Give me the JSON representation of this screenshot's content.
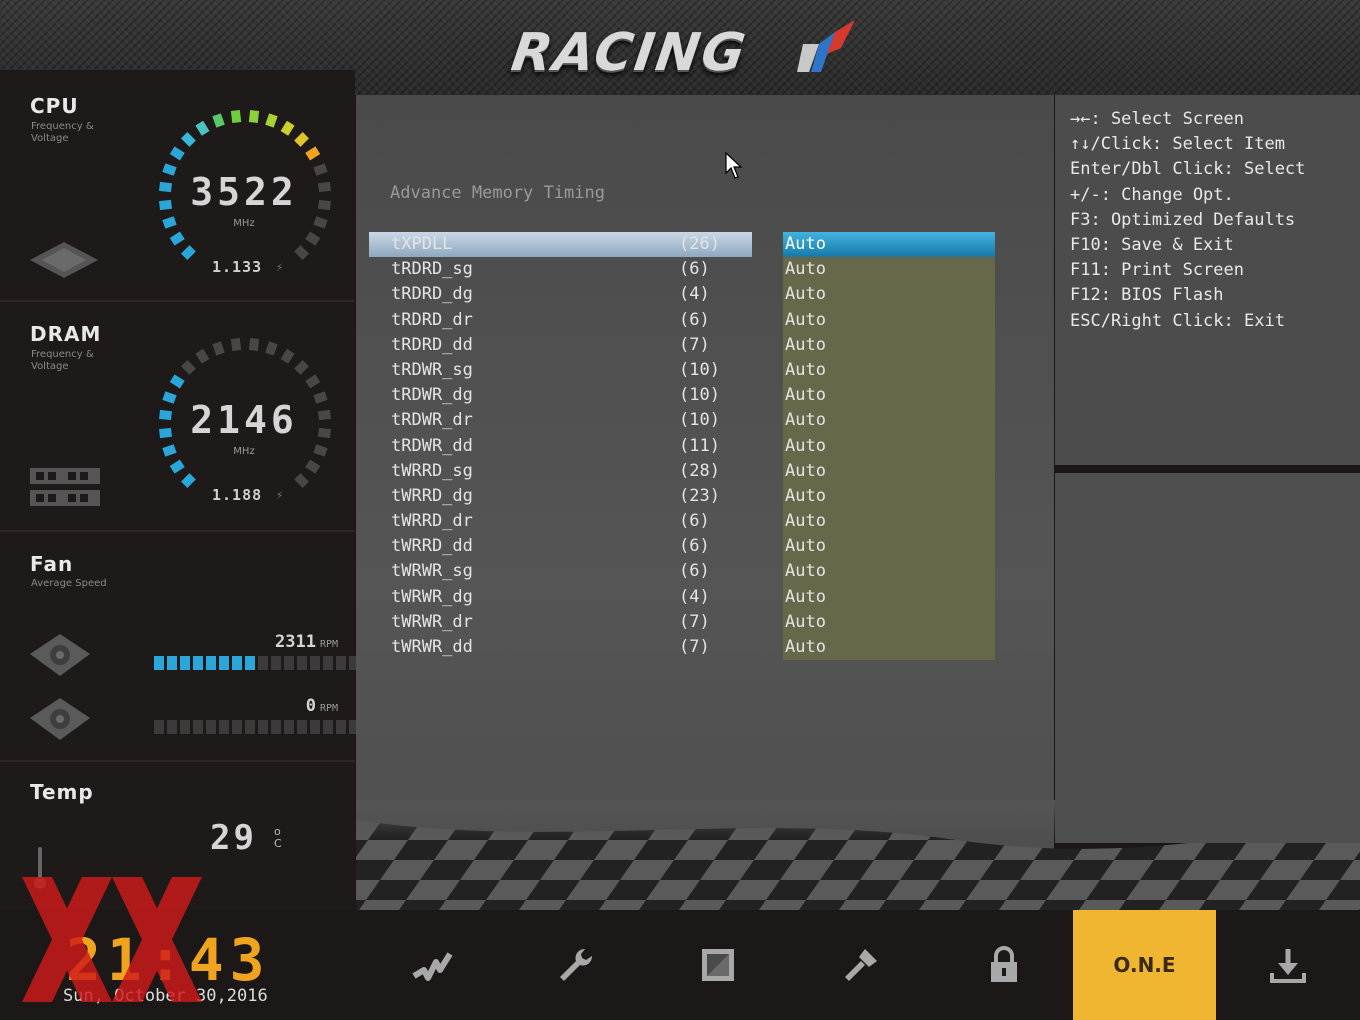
{
  "header": {
    "logo_text": "RACING"
  },
  "sidebar": {
    "cpu": {
      "title": "CPU",
      "subtitle": "Frequency & Voltage",
      "value": "3522",
      "unit": "MHz",
      "voltage": "1.133"
    },
    "dram": {
      "title": "DRAM",
      "subtitle": "Frequency & Voltage",
      "value": "2146",
      "unit": "MHz",
      "voltage": "1.188"
    },
    "fan": {
      "title": "Fan",
      "subtitle": "Average Speed",
      "fan1_rpm": "2311",
      "fan1_level": 0.5,
      "fan2_rpm": "0",
      "fan2_level": 0,
      "rpm_unit": "RPM"
    },
    "temp": {
      "title": "Temp",
      "value": "29",
      "unit_deg": "o",
      "unit_c": "C"
    }
  },
  "main": {
    "page_title": "Advance Memory Timing",
    "rows": [
      {
        "name": "tXPDLL",
        "current": "(26)",
        "value": "Auto"
      },
      {
        "name": "tRDRD_sg",
        "current": "(6)",
        "value": "Auto"
      },
      {
        "name": "tRDRD_dg",
        "current": "(4)",
        "value": "Auto"
      },
      {
        "name": "tRDRD_dr",
        "current": "(6)",
        "value": "Auto"
      },
      {
        "name": "tRDRD_dd",
        "current": "(7)",
        "value": "Auto"
      },
      {
        "name": "tRDWR_sg",
        "current": "(10)",
        "value": "Auto"
      },
      {
        "name": "tRDWR_dg",
        "current": "(10)",
        "value": "Auto"
      },
      {
        "name": "tRDWR_dr",
        "current": "(10)",
        "value": "Auto"
      },
      {
        "name": "tRDWR_dd",
        "current": "(11)",
        "value": "Auto"
      },
      {
        "name": "tWRRD_sg",
        "current": "(28)",
        "value": "Auto"
      },
      {
        "name": "tWRRD_dg",
        "current": "(23)",
        "value": "Auto"
      },
      {
        "name": "tWRRD_dr",
        "current": "(6)",
        "value": "Auto"
      },
      {
        "name": "tWRRD_dd",
        "current": "(6)",
        "value": "Auto"
      },
      {
        "name": "tWRWR_sg",
        "current": "(6)",
        "value": "Auto"
      },
      {
        "name": "tWRWR_dg",
        "current": "(4)",
        "value": "Auto"
      },
      {
        "name": "tWRWR_dr",
        "current": "(7)",
        "value": "Auto"
      },
      {
        "name": "tWRWR_dd",
        "current": "(7)",
        "value": "Auto"
      }
    ]
  },
  "help": [
    "→←: Select Screen",
    "↑↓/Click: Select Item",
    "Enter/Dbl Click: Select",
    "+/-: Change Opt.",
    "F3: Optimized Defaults",
    "F10: Save & Exit",
    "F11: Print Screen",
    "F12: BIOS Flash",
    "ESC/Right Click: Exit"
  ],
  "bottom": {
    "clock": "21:43",
    "date": "Sun, October  30,2016",
    "one_label": "O.N.E",
    "icons": [
      "overclock-icon",
      "wrench-icon",
      "chipset-icon",
      "tools-icon",
      "lock-icon",
      "one-tab",
      "download-icon"
    ]
  },
  "colors": {
    "accent_blue": "#2aa6d9",
    "accent_orange": "#f1b631",
    "value_bg": "#67674a"
  }
}
